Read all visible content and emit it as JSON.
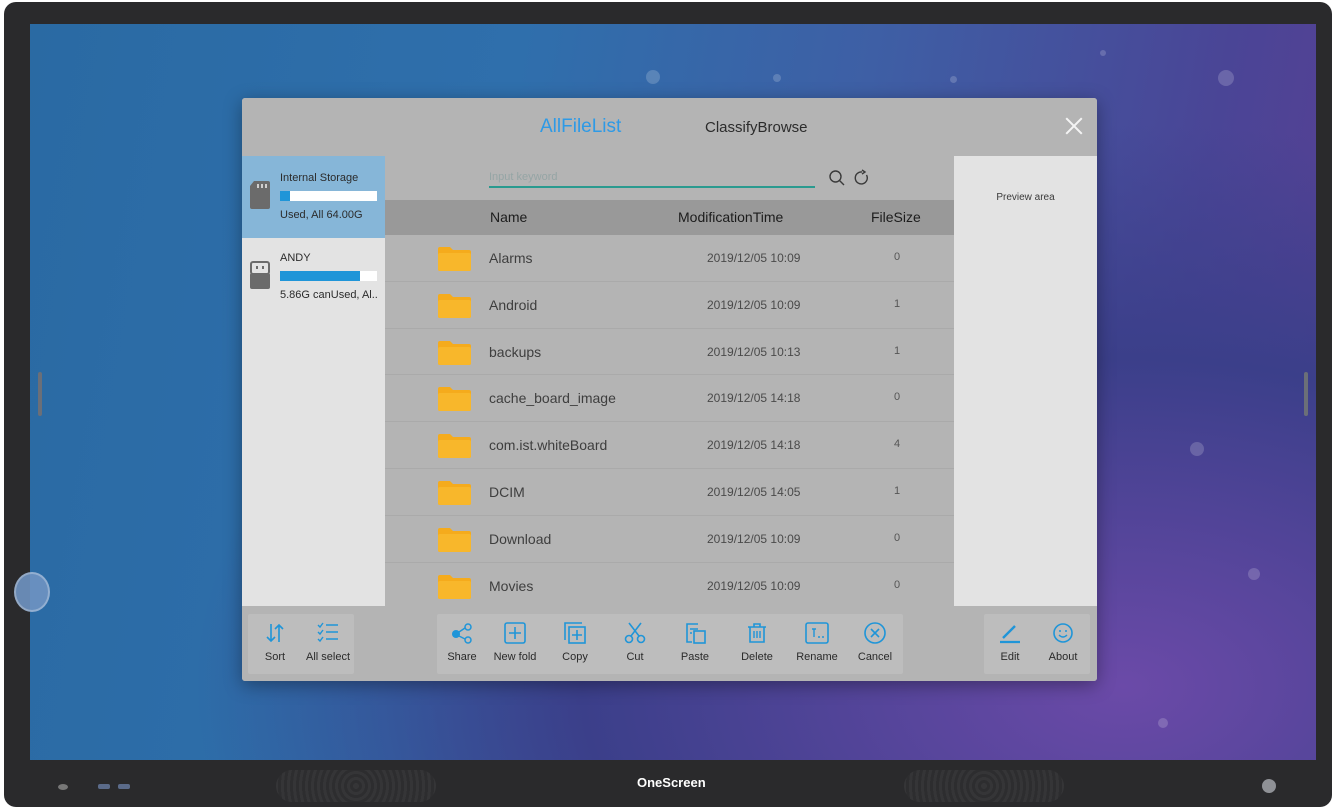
{
  "colors": {
    "accent": "#2e9ae6",
    "selected_drive": "#86b6d8",
    "usage_bar": "#1f95d8",
    "folder": "#f5ab1c",
    "toolbar_icon": "#1f95d8",
    "search_underline": "#2a9a8f"
  },
  "device": {
    "brand": "OneScreen"
  },
  "header": {
    "tab_active": "AllFileList",
    "tab_inactive": "ClassifyBrowse",
    "close_icon": "close-icon"
  },
  "drives": [
    {
      "name": "Internal Storage",
      "usage_text": "Used, All 64.00G",
      "usage_fraction": 0.1,
      "icon": "sd-card-icon",
      "selected": true
    },
    {
      "name": "ANDY",
      "usage_text": "5.86G canUsed, Al..",
      "usage_fraction": 0.82,
      "icon": "usb-drive-icon",
      "selected": false
    }
  ],
  "search": {
    "placeholder": "Input keyword",
    "value": ""
  },
  "columns": {
    "name": "Name",
    "time": "ModificationTime",
    "size": "FileSize"
  },
  "files": [
    {
      "name": "Alarms",
      "time": "2019/12/05 10:09",
      "size": "0"
    },
    {
      "name": "Android",
      "time": "2019/12/05 10:09",
      "size": "1"
    },
    {
      "name": "backups",
      "time": "2019/12/05 10:13",
      "size": "1"
    },
    {
      "name": "cache_board_image",
      "time": "2019/12/05 14:18",
      "size": "0"
    },
    {
      "name": "com.ist.whiteBoard",
      "time": "2019/12/05 14:18",
      "size": "4"
    },
    {
      "name": "DCIM",
      "time": "2019/12/05 14:05",
      "size": "1"
    },
    {
      "name": "Download",
      "time": "2019/12/05 10:09",
      "size": "0"
    },
    {
      "name": "Movies",
      "time": "2019/12/05 10:09",
      "size": "0"
    }
  ],
  "preview": {
    "label": "Preview area"
  },
  "toolbar": {
    "left": [
      {
        "label": "Sort",
        "icon": "sort-icon"
      },
      {
        "label": "All select",
        "icon": "checklist-icon"
      }
    ],
    "middle": [
      {
        "label": "Share",
        "icon": "share-icon"
      },
      {
        "label": "New fold",
        "icon": "new-folder-icon"
      },
      {
        "label": "Copy",
        "icon": "copy-icon"
      },
      {
        "label": "Cut",
        "icon": "scissors-icon"
      },
      {
        "label": "Paste",
        "icon": "paste-icon"
      },
      {
        "label": "Delete",
        "icon": "trash-icon"
      },
      {
        "label": "Rename",
        "icon": "rename-icon"
      },
      {
        "label": "Cancel",
        "icon": "cancel-icon"
      }
    ],
    "right": [
      {
        "label": "Edit",
        "icon": "edit-icon"
      },
      {
        "label": "About",
        "icon": "smiley-icon"
      }
    ]
  }
}
